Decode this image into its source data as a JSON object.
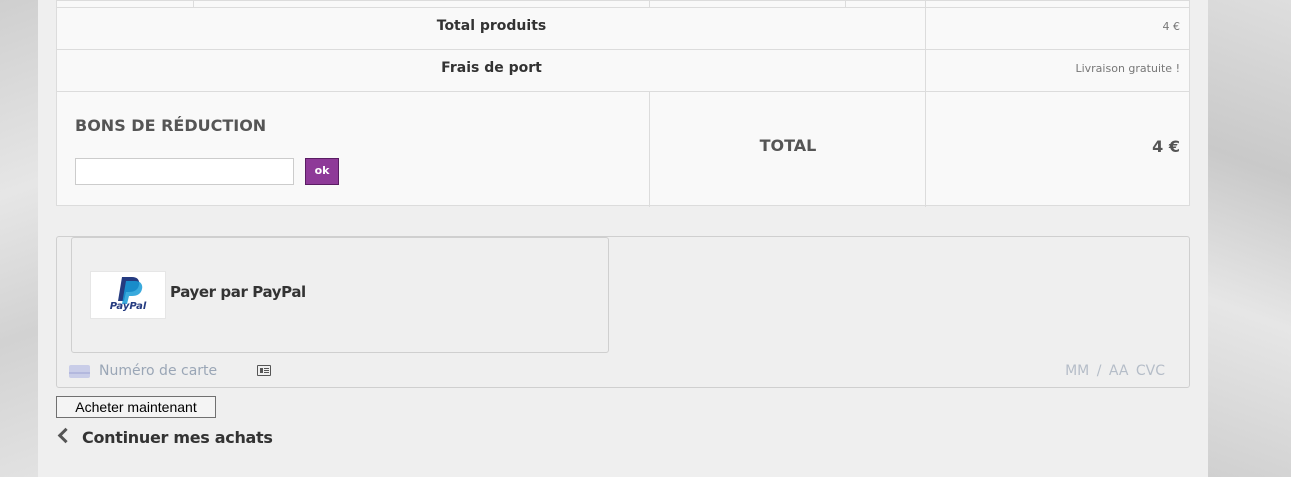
{
  "summary": {
    "total_products_label": "Total produits",
    "total_products_value": "4 €",
    "shipping_label": "Frais de port",
    "shipping_value": "Livraison gratuite !",
    "total_label": "TOTAL",
    "total_value": "4 €"
  },
  "voucher": {
    "title": "BONS DE RÉDUCTION",
    "input_value": "",
    "submit_label": "ok"
  },
  "payment": {
    "paypal_logo_text": "PayPal",
    "paypal_label": "Payer par PayPal",
    "card_number_placeholder": "Numéro de carte",
    "expiry_cvc_placeholder": "MM / AA  CVC"
  },
  "actions": {
    "buy_now_label": "Acheter maintenant",
    "continue_shopping_label": "Continuer mes achats"
  },
  "icons": {
    "paypal": "paypal-logo",
    "card": "credit-card-icon",
    "id_card": "id-card-icon",
    "back": "chevron-left-icon"
  },
  "colors": {
    "accent_button": "#8e3a98",
    "paypal_blue": "#253b80",
    "paypal_light_blue": "#179bd7"
  }
}
